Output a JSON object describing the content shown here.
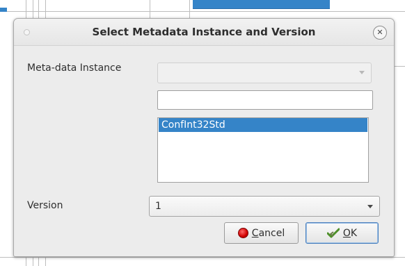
{
  "dialog": {
    "title": "Select Metadata Instance and Version",
    "instance_label": "Meta-data Instance",
    "instance_filter_value": "",
    "instance_list": [
      "ConfInt32Std"
    ],
    "selected_instance_index": 0,
    "version_label": "Version",
    "version_value": "1",
    "cancel_label": "ancel",
    "cancel_mnemonic": "C",
    "ok_label": "K",
    "ok_mnemonic": "O"
  },
  "colors": {
    "selection": "#3584c8",
    "dialog_bg": "#ececec"
  },
  "icons": {
    "cancel": "stop-circle-red",
    "ok": "checkmark-arrow-green"
  }
}
